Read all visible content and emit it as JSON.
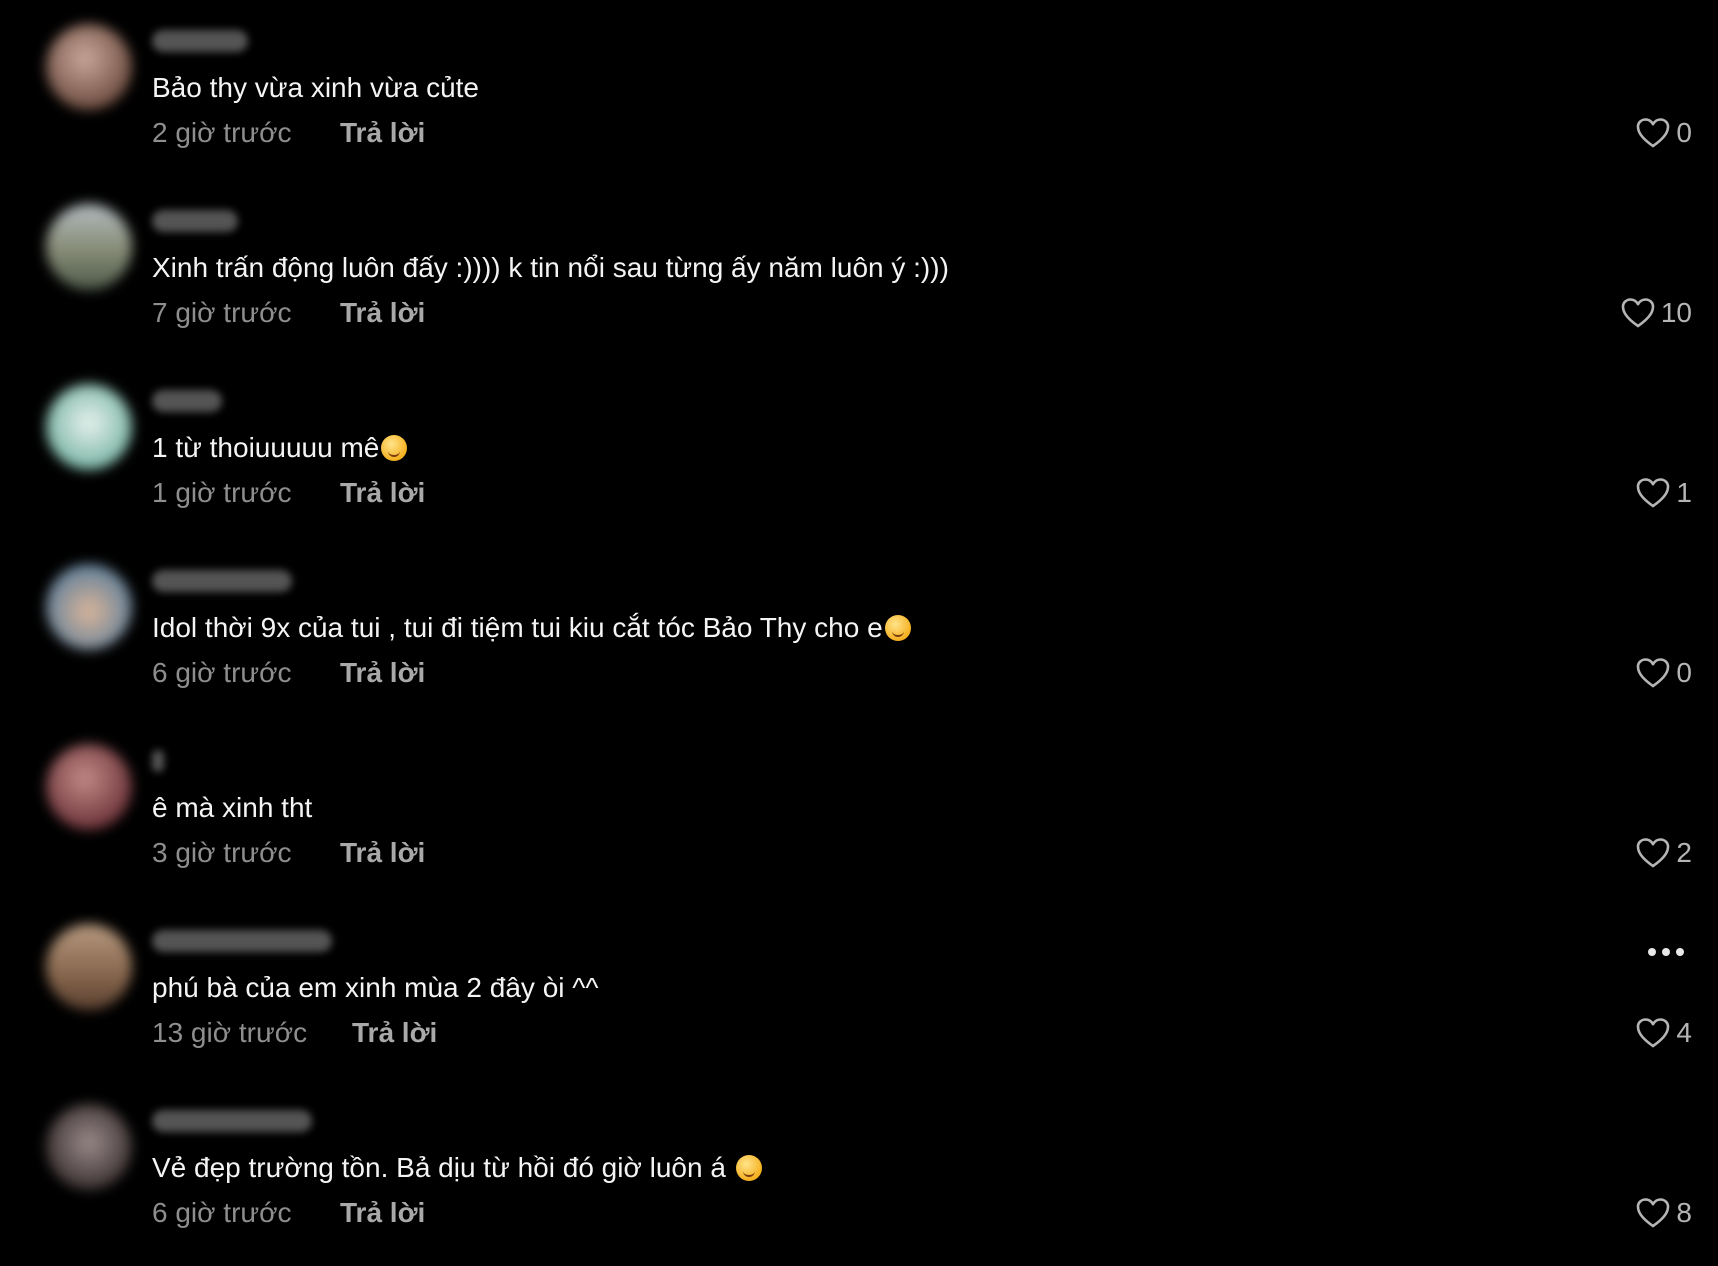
{
  "comments": [
    {
      "text": "Bảo thy vừa xinh vừa củte",
      "time": "2 giờ trước",
      "reply": "Trả lời",
      "likes": "0",
      "avatar_colors": [
        "#c9a89a",
        "#6b4a3e"
      ]
    },
    {
      "text": "Xinh trấn động luôn đấy :)))) k tin nổi sau từng ấy năm luôn ý :)))",
      "time": "7 giờ trước",
      "reply": "Trả lời",
      "likes": "10",
      "avatar_colors": [
        "#b4bcc2",
        "#4f5a4a"
      ]
    },
    {
      "text": "1 từ thoiuuuuu mê",
      "time": "1 giờ trước",
      "reply": "Trả lời",
      "likes": "1",
      "avatar_colors": [
        "#e6f2ee",
        "#7fb7a8"
      ],
      "emoji": "smiling-hearts-emoji"
    },
    {
      "text": "Idol thời 9x của tui , tui đi tiệm tui kiu cắt tóc Bảo Thy cho e",
      "time": "6 giờ trước",
      "reply": "Trả lời",
      "likes": "0",
      "avatar_colors": [
        "#d9b59a",
        "#5f7f9a"
      ],
      "emoji": "grinning-squint-emoji"
    },
    {
      "text": "ê mà xinh tht",
      "time": "3 giờ trước",
      "reply": "Trả lời",
      "likes": "2",
      "avatar_colors": [
        "#c28a86",
        "#6a3138"
      ]
    },
    {
      "text": "phú bà của em xinh mùa 2 đây òi ^^",
      "time": "13 giờ trước",
      "reply": "Trả lời",
      "likes": "4",
      "avatar_colors": [
        "#b79a80",
        "#5a4030"
      ],
      "has_more_menu": true
    },
    {
      "text": "Vẻ đẹp trường tồn. Bả dịu từ hồi đó giờ luôn á",
      "time": "6 giờ trước",
      "reply": "Trả lời",
      "likes": "8",
      "avatar_colors": [
        "#9a8a8a",
        "#3a3030"
      ],
      "emoji": "smiling-hearts-emoji"
    }
  ],
  "colors": {
    "background": "#000000",
    "text": "#f4f4f4",
    "muted": "#8e8e8e"
  }
}
